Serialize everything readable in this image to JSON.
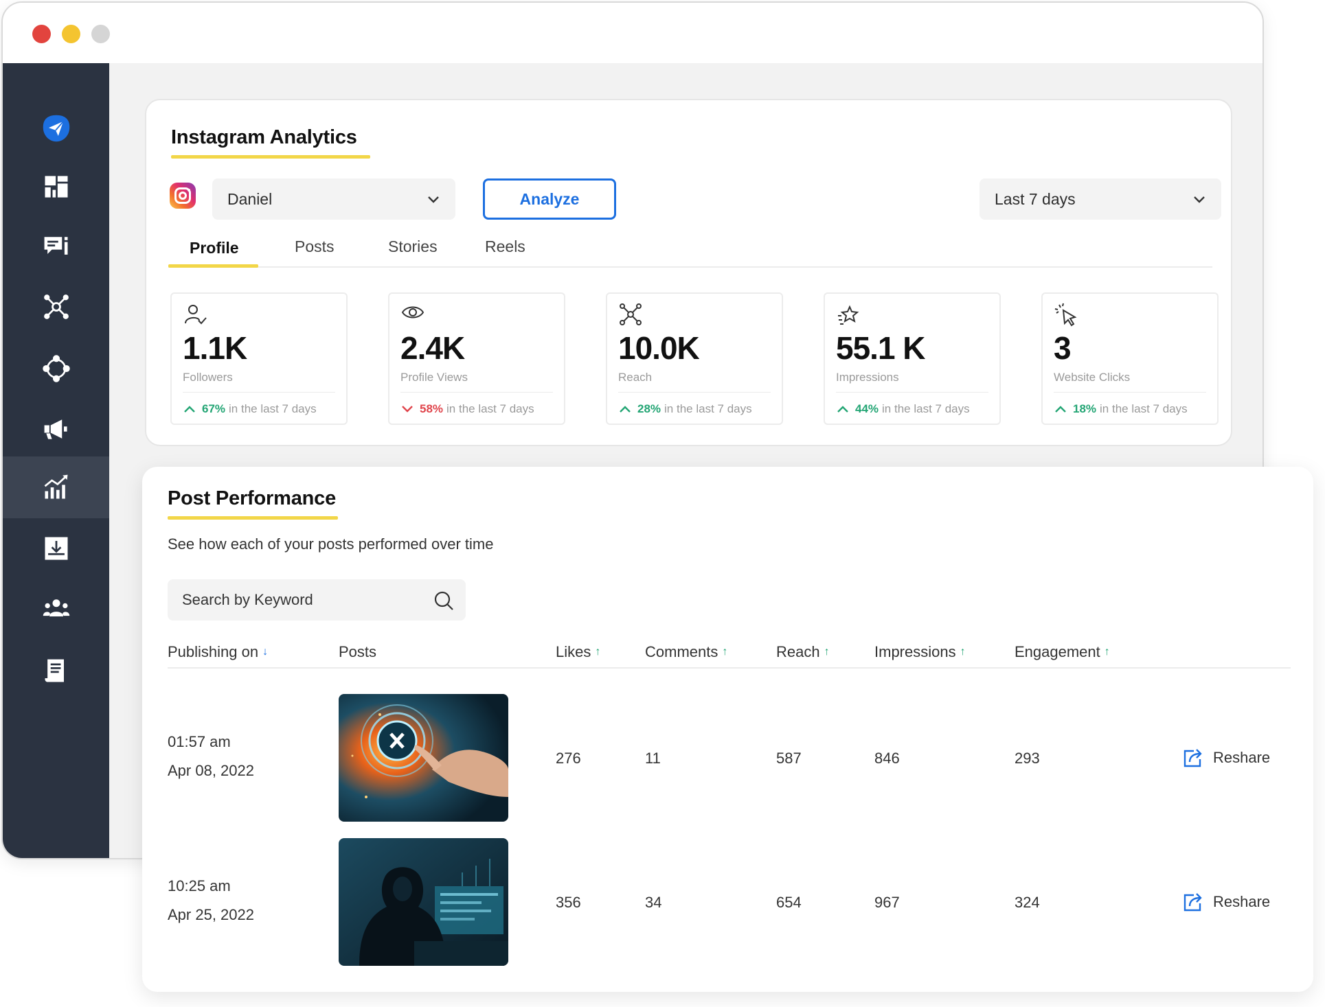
{
  "colors": {
    "accent": "#1c6fe0",
    "sidebar": "#2b3341",
    "underline": "#f2d648",
    "up": "#23a574",
    "down": "#e0454c"
  },
  "sidebar": {
    "items": [
      {
        "icon": "paper-plane-logo-icon"
      },
      {
        "icon": "dashboard-grid-icon"
      },
      {
        "icon": "chat-messages-icon"
      },
      {
        "icon": "network-hub-icon"
      },
      {
        "icon": "circular-nodes-icon"
      },
      {
        "icon": "megaphone-icon"
      },
      {
        "icon": "analytics-chart-icon",
        "active": true
      },
      {
        "icon": "inbox-download-icon"
      },
      {
        "icon": "team-users-icon"
      },
      {
        "icon": "report-document-icon"
      }
    ]
  },
  "analytics": {
    "title": "Instagram Analytics",
    "account_select": "Daniel",
    "analyze_label": "Analyze",
    "range_select": "Last 7 days",
    "tabs": [
      "Profile",
      "Posts",
      "Stories",
      "Reels"
    ],
    "active_tab": "Profile",
    "stats": [
      {
        "icon": "followers-user-icon",
        "value": "1.1K",
        "label": "Followers",
        "pct": "67%",
        "dir": "up",
        "suffix": "in the last 7 days"
      },
      {
        "icon": "eye-icon",
        "value": "2.4K",
        "label": "Profile Views",
        "pct": "58%",
        "dir": "down",
        "suffix": "in the last 7 days"
      },
      {
        "icon": "reach-network-icon",
        "value": "10.0K",
        "label": "Reach",
        "pct": "28%",
        "dir": "up",
        "suffix": "in the last 7 days"
      },
      {
        "icon": "star-sparkle-icon",
        "value": "55.1 K",
        "label": "Impressions",
        "pct": "44%",
        "dir": "up",
        "suffix": "in the last 7 days"
      },
      {
        "icon": "cursor-click-icon",
        "value": "3",
        "label": "Website Clicks",
        "pct": "18%",
        "dir": "up",
        "suffix": "in the last 7 days"
      }
    ]
  },
  "performance": {
    "title": "Post Performance",
    "subtitle": "See how each of your posts performed over time",
    "search_placeholder": "Search by Keyword",
    "columns": {
      "publishing": "Publishing on",
      "posts": "Posts",
      "likes": "Likes",
      "comments": "Comments",
      "reach": "Reach",
      "impressions": "Impressions",
      "engagement": "Engagement"
    },
    "rows": [
      {
        "time": "01:57 am",
        "date": "Apr 08, 2022",
        "thumb": "tech-hand-touch-image",
        "likes": "276",
        "comments": "11",
        "reach": "587",
        "impressions": "846",
        "engagement": "293",
        "action": "Reshare"
      },
      {
        "time": "10:25 am",
        "date": "Apr 25, 2022",
        "thumb": "hooded-hacker-image",
        "likes": "356",
        "comments": "34",
        "reach": "654",
        "impressions": "967",
        "engagement": "324",
        "action": "Reshare"
      }
    ]
  }
}
